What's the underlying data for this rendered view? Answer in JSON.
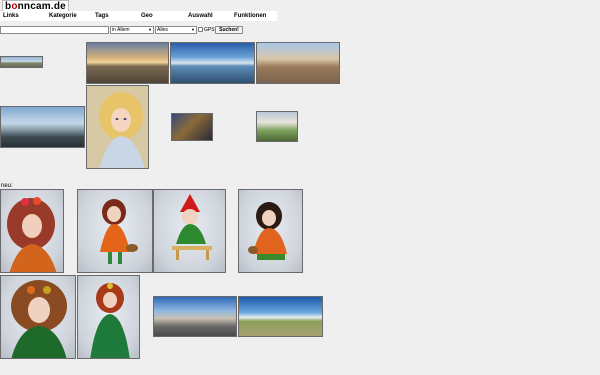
{
  "site": {
    "logo_prefix": "b",
    "logo_o": "o",
    "logo_rest": "nncam.de"
  },
  "menu": [
    "Links",
    "Kategorie",
    "Tags",
    "Geo",
    "Auswahl",
    "Funktionen"
  ],
  "search": {
    "query": "",
    "scope_selected": "in Allem",
    "filter_selected": "Alles",
    "gps_label": "GPS",
    "button_label": "Suchen!"
  },
  "section_new_label": "neu:",
  "colors": {
    "page_bg": "#efefef",
    "logo_accent": "#c00000"
  },
  "thumbnails": {
    "row1": [
      "panorama-strip",
      "panorama-sunset-square",
      "panorama-harbor-sea",
      "panorama-old-town-street"
    ],
    "row2": [
      "panorama-fisheye-lake",
      "doll-blonde-fairy",
      "photo-dark-interior",
      "photo-garden-house"
    ],
    "new_row1": [
      "doll-red-curly-flower",
      "doll-orange-basket",
      "doll-red-hat-bench",
      "doll-dark-hair-basket"
    ],
    "new_row2": [
      "doll-green-dress-curly",
      "doll-green-dress-red",
      "panorama-village-street",
      "panorama-meadow-sky"
    ]
  }
}
